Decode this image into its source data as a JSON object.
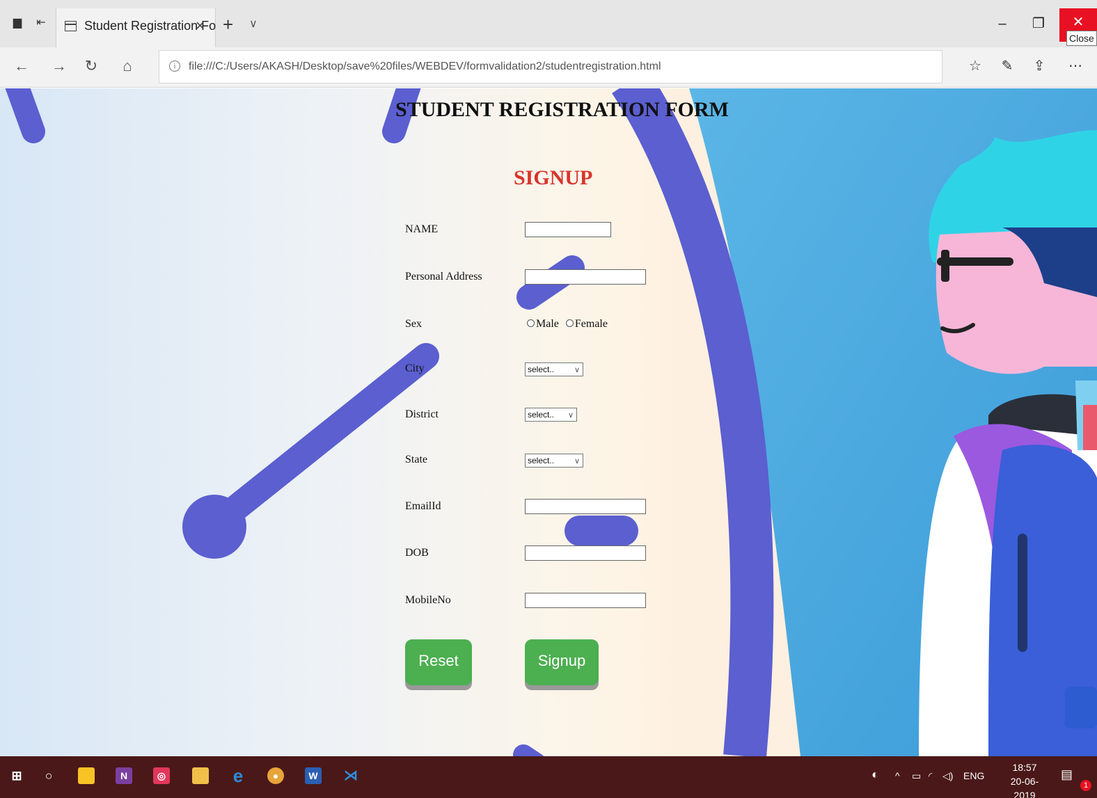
{
  "browser": {
    "tab_title": "Student Registration Fo",
    "tab_close": "×",
    "new_tab": "+",
    "tab_menu": "∨",
    "url": "file:///C:/Users/AKASH/Desktop/save%20files/WEBDEV/formvalidation2/studentregistration.html",
    "close_tooltip": "Close",
    "icons": [
      "back-icon",
      "forward-icon",
      "refresh-icon",
      "home-icon",
      "info-icon",
      "favorites-icon",
      "notes-icon",
      "share-icon",
      "more-icon"
    ]
  },
  "page": {
    "title": "STUDENT REGISTRATION FORM",
    "signup_heading": "SIGNUP",
    "labels": {
      "name": "NAME",
      "address": "Personal Address",
      "sex": "Sex",
      "city": "City",
      "district": "District",
      "state": "State",
      "email": "EmailId",
      "dob": "DOB",
      "mobile": "MobileNo"
    },
    "sex_options": {
      "male": "Male",
      "female": "Female"
    },
    "selects": {
      "city": "select..",
      "district": "select..",
      "state": "select.."
    },
    "buttons": {
      "reset": "Reset",
      "signup": "Signup"
    },
    "colors": {
      "signup_heading": "#d9342b",
      "button": "#4caf50",
      "clock_hands": "#5b5fd0"
    }
  },
  "taskbar": {
    "language": "ENG",
    "time": "18:57",
    "date": "20-06-2019",
    "notification_count": "1",
    "apps": [
      "start-icon",
      "cortana-icon",
      "sticky-notes-icon",
      "onenote-icon",
      "instagram-icon",
      "file-explorer-icon",
      "edge-icon",
      "chrome-icon",
      "word-icon",
      "vscode-icon"
    ]
  }
}
